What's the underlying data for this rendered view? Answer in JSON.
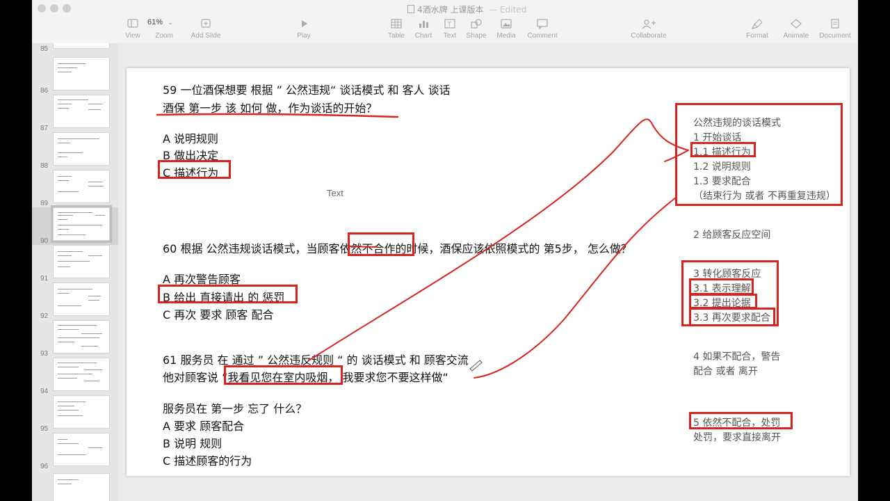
{
  "window": {
    "title": "4酒水牌 上课版本",
    "edited": "— Edited"
  },
  "toolbar": {
    "view": "View",
    "zoom_value": "61%",
    "zoom": "Zoom",
    "add_slide": "Add Slide",
    "play": "Play",
    "table": "Table",
    "chart": "Chart",
    "text": "Text",
    "shape": "Shape",
    "media": "Media",
    "comment": "Comment",
    "collaborate": "Collaborate",
    "format": "Format",
    "animate": "Animate",
    "document": "Document"
  },
  "sidebar": {
    "slide_numbers": [
      "85",
      "86",
      "87",
      "88",
      "89",
      "90",
      "91",
      "92",
      "93",
      "94",
      "95",
      "96"
    ],
    "selected": "90"
  },
  "slide": {
    "text_placeholder": "Text",
    "q59": {
      "line1": "59 一位酒保想要 根据 ” 公然违规“ 谈话模式 和 客人 谈话",
      "line2": "酒保 第一步 该 如何 做，作为谈话的开始？",
      "a": "A 说明规则",
      "b": "B 做出决定",
      "c": "C 描述行为"
    },
    "q60": {
      "line1": "60 根据 公然违规谈话模式，当顾客依然不合作的时候，酒保应该依照模式的 第5步， 怎么做？",
      "a": "A 再次警告顾客",
      "b": "B 给出 直接请出 的 惩罚",
      "c": "C 再次 要求 顾客 配合"
    },
    "q61": {
      "line1": "61 服务员 在 通过 ” 公然违反规则 “ 的 谈话模式 和 顾客交流",
      "line2": "他对顾客说 “我看见您在室内吸烟， 我要求您不要这样做“",
      "line3": "服务员在 第一步 忘了 什么？",
      "a": "A 要求 顾客配合",
      "b": "B 说明 规则",
      "c": "C 描述顾客的行为"
    },
    "ref": {
      "title": "公然违规的谈话模式",
      "s1": "1 开始谈话",
      "s1_1": "1.1 描述行为",
      "s1_2": "1.2 说明规则",
      "s1_3": "1.3 要求配合",
      "s1_note": "（结束行为 或者 不再重复违规）",
      "s2": "2 给顾客反应空间",
      "s3": "3 转化顾客反应",
      "s3_1": "3.1 表示理解",
      "s3_2": "3.2 提出论据",
      "s3_3": "3.3 再次要求配合",
      "s4a": "4 如果不配合，警告",
      "s4b": "配合 或者 离开",
      "s5a": "5 依然不配合，处罚",
      "s5b": "处罚，要求直接离开"
    }
  },
  "annotations": {
    "ink_color": "#d8231f"
  }
}
